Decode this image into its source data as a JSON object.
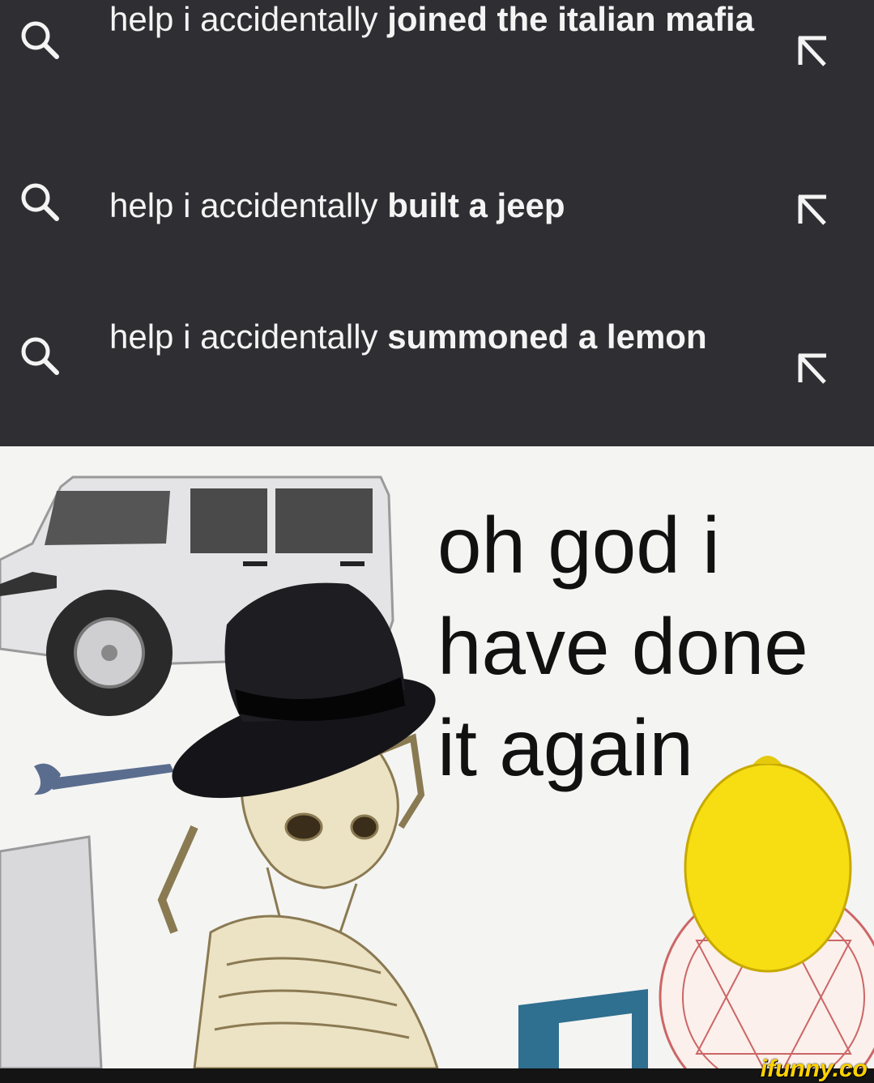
{
  "suggestions": [
    {
      "prefix": "help i accidentally",
      "completion": "joined the italian mafia",
      "search_icon": "search-icon",
      "fill_icon": "arrow-up-left-icon"
    },
    {
      "prefix": "help i accidentally",
      "completion": "built a jeep",
      "search_icon": "search-icon",
      "fill_icon": "arrow-up-left-icon"
    },
    {
      "prefix": "help i accidentally",
      "completion": "summoned a lemon",
      "search_icon": "search-icon",
      "fill_icon": "arrow-up-left-icon"
    }
  ],
  "meme": {
    "caption_lines": [
      "oh god i",
      "have done",
      "it again"
    ],
    "watermark": "ifunny.co"
  },
  "colors": {
    "dark_panel": "#2f2f33",
    "suggestion_text": "#f4f4f4",
    "meme_background": "#f4f4f2",
    "lemon": "#f6de12",
    "watermark": "#ffd200"
  }
}
